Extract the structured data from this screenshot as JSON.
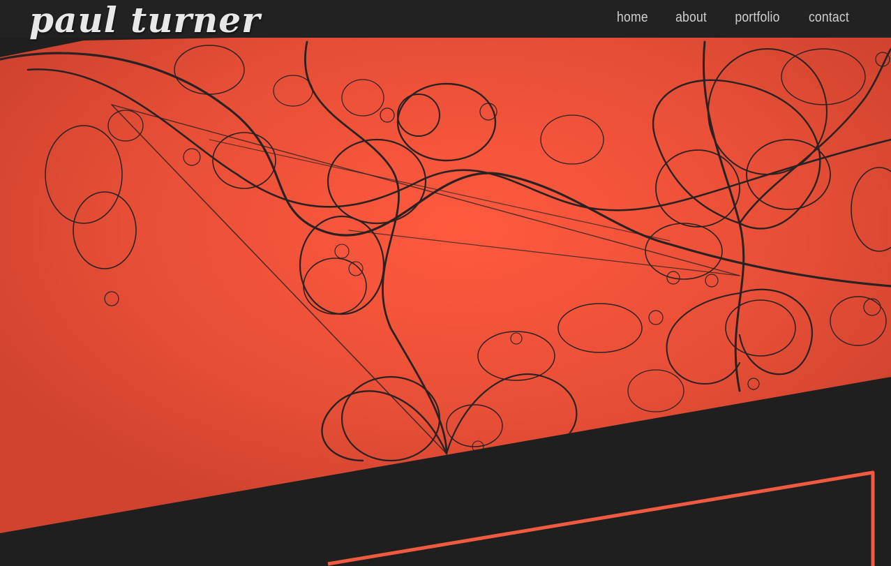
{
  "site": {
    "logo_text": "paul turner"
  },
  "nav": {
    "items": [
      {
        "label": "home"
      },
      {
        "label": "about"
      },
      {
        "label": "portfolio"
      },
      {
        "label": "contact"
      }
    ]
  },
  "colors": {
    "accent": "#f05a40",
    "background": "#1f1f1f",
    "header": "#222222",
    "line_art": "#2a2222"
  }
}
